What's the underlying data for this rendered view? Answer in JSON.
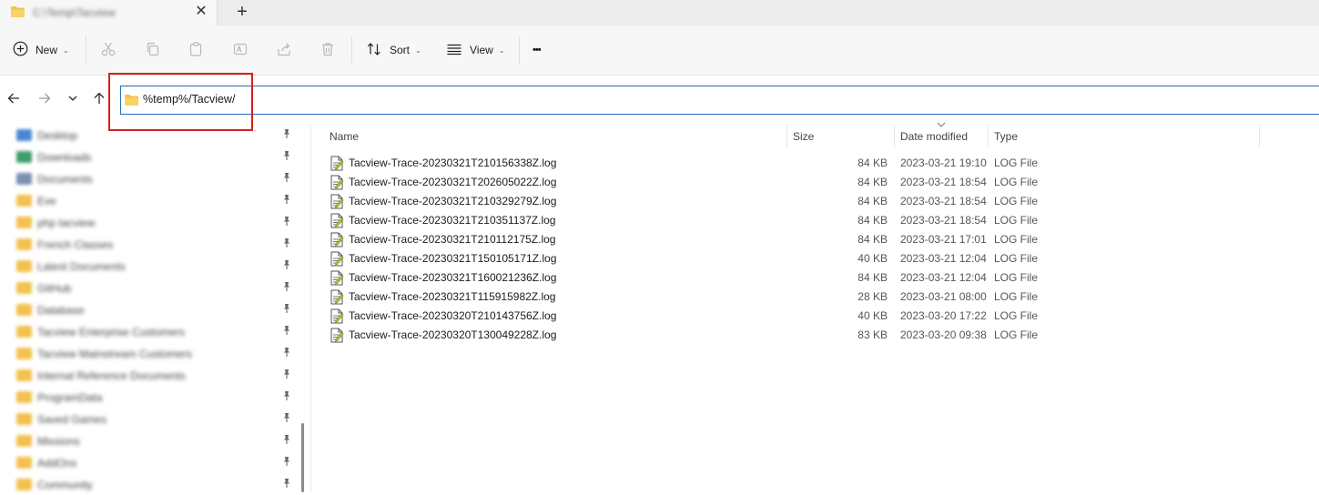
{
  "tab": {
    "title": "C:\\Temp\\Tacview",
    "close_glyph": "✕",
    "new_glyph": "+"
  },
  "toolbar": {
    "new_label": "New",
    "sort_label": "Sort",
    "view_label": "View",
    "more_glyph": "•••",
    "chevron": "⌄"
  },
  "address": {
    "value": "%temp%/Tacview/"
  },
  "sidebar": {
    "items": [
      {
        "label": "Desktop",
        "icon": "desktop-icon",
        "color": "#4a86d6"
      },
      {
        "label": "Downloads",
        "icon": "downloads-icon",
        "color": "#3e9e6a"
      },
      {
        "label": "Documents",
        "icon": "documents-icon",
        "color": "#7a90b0"
      },
      {
        "label": "Eve",
        "icon": "folder-icon",
        "color": "#f2c14e"
      },
      {
        "label": "php tacview",
        "icon": "folder-icon",
        "color": "#f2c14e"
      },
      {
        "label": "French Classes",
        "icon": "folder-icon",
        "color": "#f2c14e"
      },
      {
        "label": "Latest Documents",
        "icon": "folder-icon",
        "color": "#f2c14e"
      },
      {
        "label": "GitHub",
        "icon": "folder-icon",
        "color": "#f2c14e"
      },
      {
        "label": "Database",
        "icon": "folder-icon",
        "color": "#f2c14e"
      },
      {
        "label": "Tacview Enterprise Customers",
        "icon": "folder-icon",
        "color": "#f2c14e"
      },
      {
        "label": "Tacview Mainstream Customers",
        "icon": "folder-icon",
        "color": "#f2c14e"
      },
      {
        "label": "Internal Reference Documents",
        "icon": "folder-icon",
        "color": "#f2c14e"
      },
      {
        "label": "ProgramData",
        "icon": "folder-icon",
        "color": "#f2c14e"
      },
      {
        "label": "Saved Games",
        "icon": "folder-icon",
        "color": "#f2c14e"
      },
      {
        "label": "Missions",
        "icon": "folder-icon",
        "color": "#f2c14e"
      },
      {
        "label": "AddOns",
        "icon": "folder-icon",
        "color": "#f2c14e"
      },
      {
        "label": "Community",
        "icon": "folder-icon",
        "color": "#f2c14e"
      }
    ]
  },
  "columns": {
    "name": "Name",
    "size": "Size",
    "date": "Date modified",
    "type": "Type"
  },
  "files": [
    {
      "name": "Tacview-Trace-20230321T210156338Z.log",
      "size": "84 KB",
      "date": "2023-03-21 19:10",
      "type": "LOG File"
    },
    {
      "name": "Tacview-Trace-20230321T202605022Z.log",
      "size": "84 KB",
      "date": "2023-03-21 18:54",
      "type": "LOG File"
    },
    {
      "name": "Tacview-Trace-20230321T210329279Z.log",
      "size": "84 KB",
      "date": "2023-03-21 18:54",
      "type": "LOG File"
    },
    {
      "name": "Tacview-Trace-20230321T210351137Z.log",
      "size": "84 KB",
      "date": "2023-03-21 18:54",
      "type": "LOG File"
    },
    {
      "name": "Tacview-Trace-20230321T210112175Z.log",
      "size": "84 KB",
      "date": "2023-03-21 17:01",
      "type": "LOG File"
    },
    {
      "name": "Tacview-Trace-20230321T150105171Z.log",
      "size": "40 KB",
      "date": "2023-03-21 12:04",
      "type": "LOG File"
    },
    {
      "name": "Tacview-Trace-20230321T160021236Z.log",
      "size": "84 KB",
      "date": "2023-03-21 12:04",
      "type": "LOG File"
    },
    {
      "name": "Tacview-Trace-20230321T115915982Z.log",
      "size": "28 KB",
      "date": "2023-03-21 08:00",
      "type": "LOG File"
    },
    {
      "name": "Tacview-Trace-20230320T210143756Z.log",
      "size": "40 KB",
      "date": "2023-03-20 17:22",
      "type": "LOG File"
    },
    {
      "name": "Tacview-Trace-20230320T130049228Z.log",
      "size": "83 KB",
      "date": "2023-03-20 09:38",
      "type": "LOG File"
    }
  ],
  "colors": {
    "accent": "#1f6fbf",
    "highlight": "#d42020",
    "folder": "#f2c14e"
  }
}
